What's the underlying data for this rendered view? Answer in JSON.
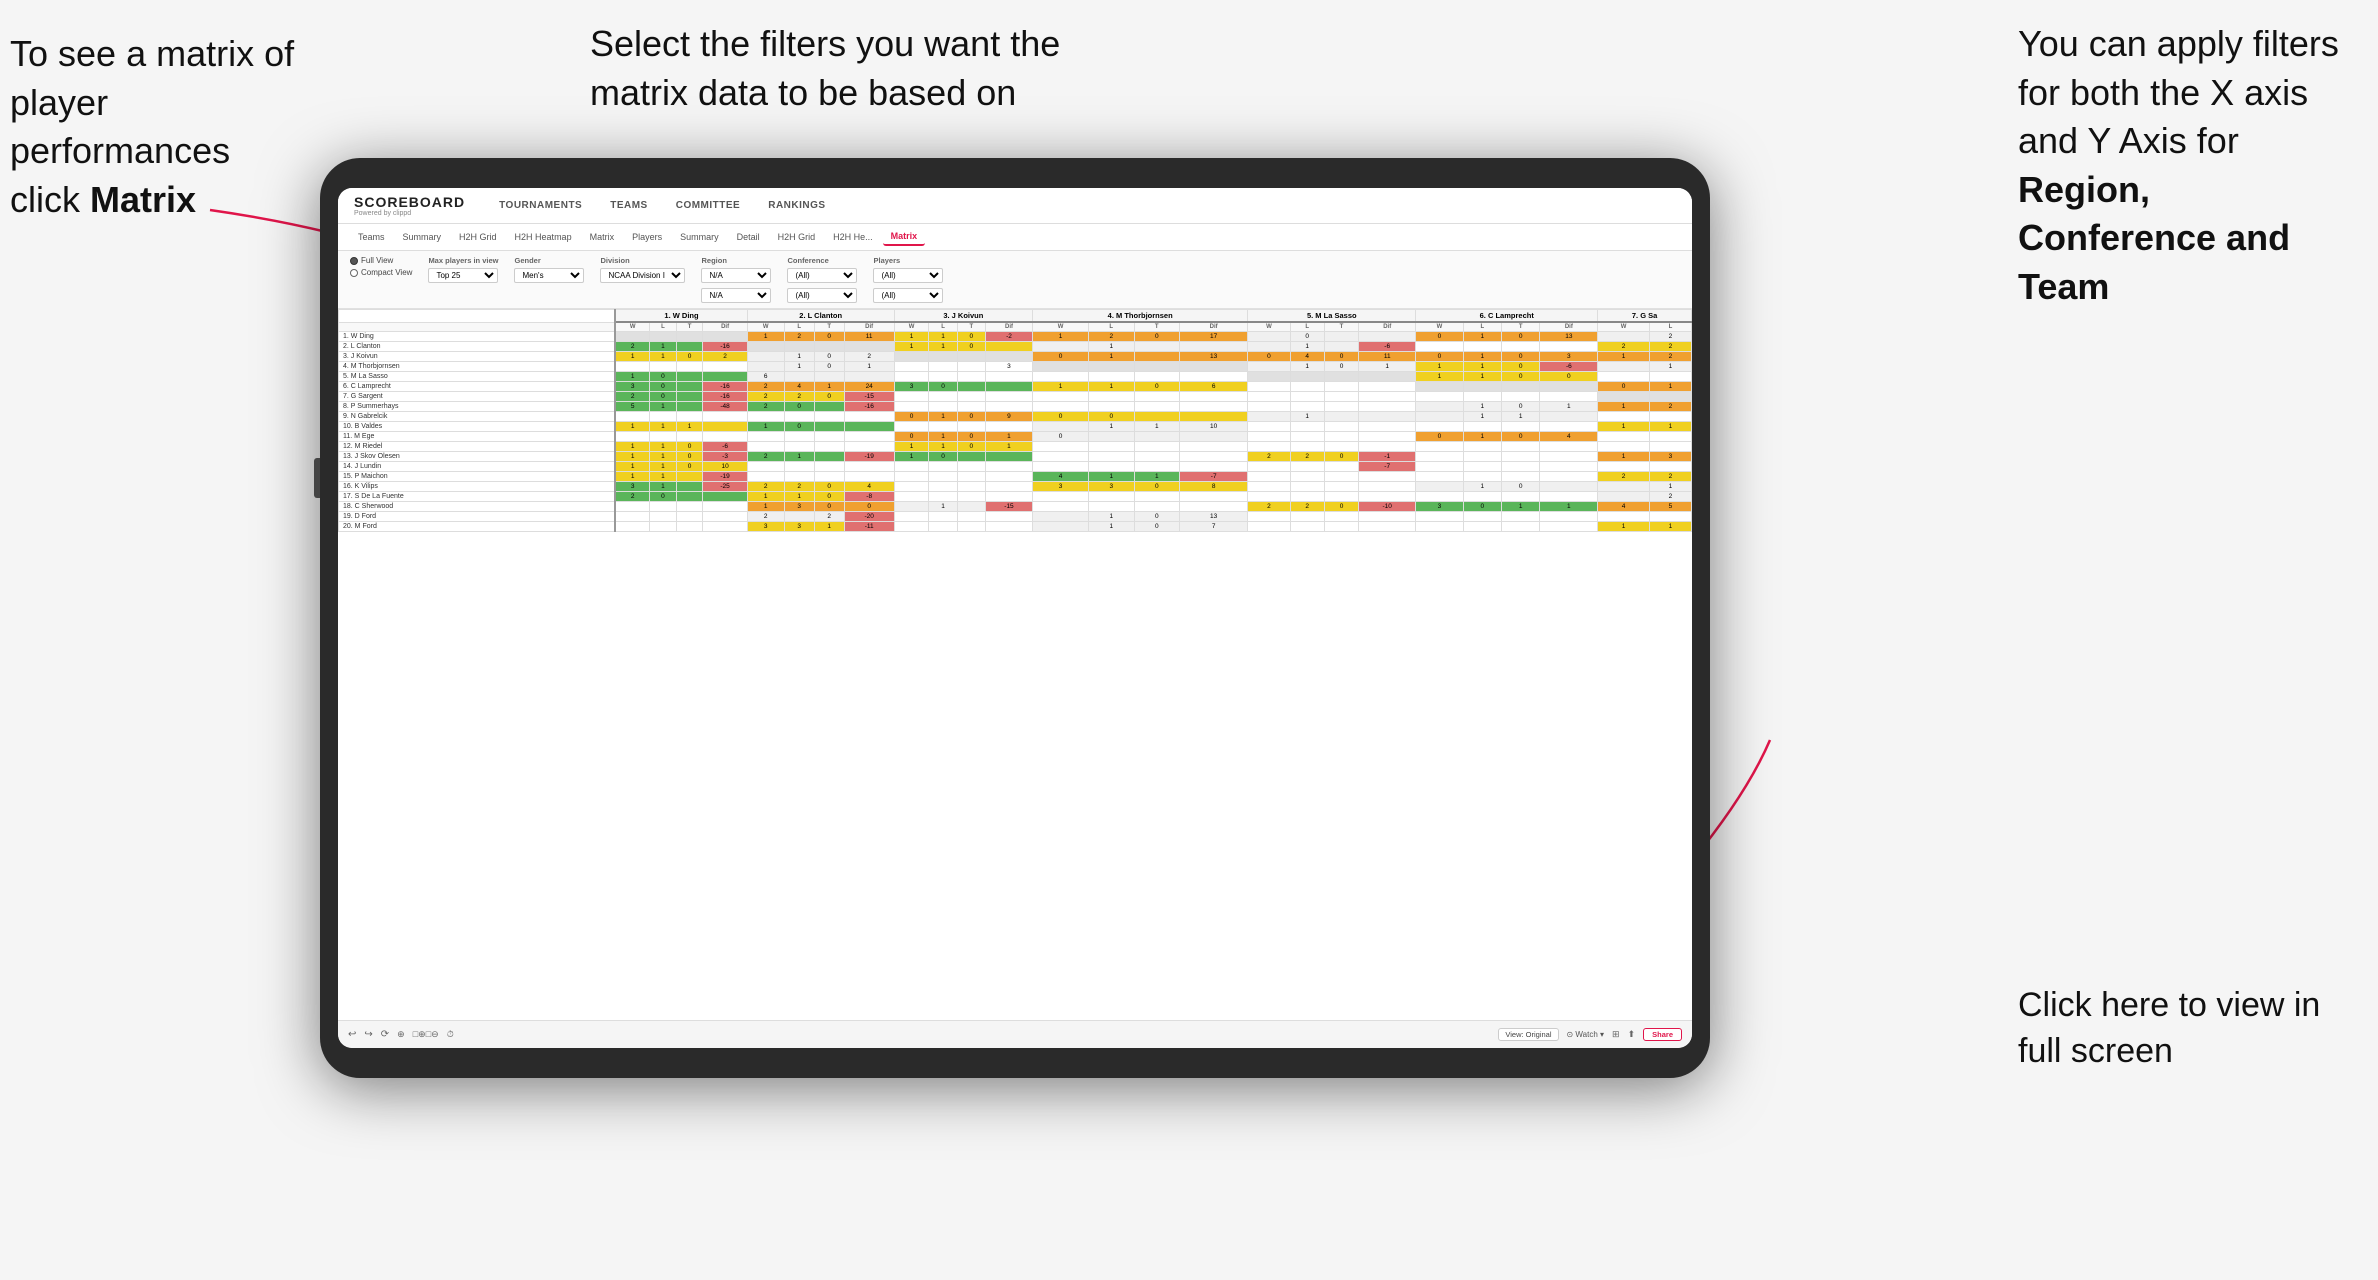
{
  "page": {
    "background": "#f5f5f5"
  },
  "annotations": {
    "top_left": {
      "line1": "To see a matrix of",
      "line2": "player performances",
      "line3": "click ",
      "bold": "Matrix"
    },
    "top_center": {
      "text": "Select the filters you want the matrix data to be based on"
    },
    "top_right": {
      "line1": "You  can apply filters for both the X axis and Y Axis for ",
      "bold1": "Region, Conference and Team"
    },
    "bottom_right": {
      "text": "Click here to view in full screen"
    }
  },
  "app": {
    "logo": "SCOREBOARD",
    "logo_sub": "Powered by clippd",
    "nav": [
      "TOURNAMENTS",
      "TEAMS",
      "COMMITTEE",
      "RANKINGS"
    ]
  },
  "sub_nav": {
    "items": [
      "Teams",
      "Summary",
      "H2H Grid",
      "H2H Heatmap",
      "Matrix",
      "Players",
      "Summary",
      "Detail",
      "H2H Grid",
      "H2H He...",
      "Matrix"
    ]
  },
  "filters": {
    "view_options": [
      "Full View",
      "Compact View"
    ],
    "selected_view": "Full View",
    "max_players_label": "Max players in view",
    "max_players_value": "Top 25",
    "gender_label": "Gender",
    "gender_value": "Men's",
    "division_label": "Division",
    "division_value": "NCAA Division I",
    "region_label": "Region",
    "region_value": "N/A",
    "conference_label": "Conference",
    "conference_value1": "(All)",
    "conference_value2": "(All)",
    "players_label": "Players",
    "players_value1": "(All)",
    "players_value2": "(All)"
  },
  "matrix": {
    "col_headers": [
      "1. W Ding",
      "2. L Clanton",
      "3. J Koivun",
      "4. M Thorbjornsen",
      "5. M La Sasso",
      "6. C Lamprecht",
      "7. G Sa"
    ],
    "sub_cols": [
      "W",
      "L",
      "T",
      "Dif"
    ],
    "rows": [
      {
        "name": "1. W Ding",
        "cells": [
          [
            null,
            null,
            null,
            null
          ],
          [
            1,
            2,
            0,
            11
          ],
          [
            1,
            1,
            0,
            null
          ],
          [
            -2
          ],
          [
            1,
            2,
            0,
            17
          ],
          [
            null,
            0,
            null,
            null
          ],
          [
            0,
            1,
            0,
            13
          ],
          [
            null,
            2
          ]
        ]
      },
      {
        "name": "2. L Clanton",
        "cells": [
          [
            2,
            1,
            null,
            -16
          ],
          [
            null,
            null,
            null,
            null
          ],
          [
            1,
            1,
            0,
            null
          ],
          [
            null
          ],
          [
            null,
            1,
            null,
            null
          ],
          [
            null,
            1,
            null,
            -6
          ],
          [
            null,
            null,
            null,
            null
          ],
          [
            2,
            2
          ]
        ]
      },
      {
        "name": "3. J Koivun",
        "cells": [
          [
            1,
            1,
            0,
            2
          ],
          [
            null,
            1,
            0,
            2
          ],
          [
            null,
            null,
            null,
            null
          ],
          [
            0,
            1,
            null,
            13
          ],
          [
            0,
            4,
            0,
            11
          ],
          [
            0,
            1,
            0,
            3
          ],
          [
            1,
            2
          ]
        ]
      },
      {
        "name": "4. M Thorbjornsen",
        "cells": [
          [
            null,
            null,
            null,
            null
          ],
          [
            null,
            1,
            0,
            1
          ],
          [
            null,
            null,
            null,
            3
          ],
          [
            null,
            null,
            null,
            null
          ],
          [
            null,
            1,
            0,
            1
          ],
          [
            1,
            1,
            0,
            -6
          ],
          [
            null,
            1
          ]
        ]
      },
      {
        "name": "5. M La Sasso",
        "cells": [
          [
            1,
            0,
            null,
            null
          ],
          [
            6,
            null,
            null,
            null
          ],
          [
            null,
            null,
            null,
            null
          ],
          [
            null,
            null,
            null,
            null
          ],
          [
            null,
            null,
            null,
            null
          ],
          [
            1,
            1,
            0,
            0
          ],
          [
            null,
            null
          ]
        ]
      },
      {
        "name": "6. C Lamprecht",
        "cells": [
          [
            3,
            0,
            null,
            -16
          ],
          [
            2,
            4,
            1,
            24
          ],
          [
            3,
            0,
            null,
            null
          ],
          [
            1,
            1,
            0,
            6
          ],
          [
            null,
            null,
            null,
            null
          ],
          [
            null,
            null,
            null,
            null
          ],
          [
            0,
            1
          ]
        ]
      },
      {
        "name": "7. G Sargent",
        "cells": [
          [
            2,
            0,
            null,
            -16
          ],
          [
            2,
            2,
            0,
            -15
          ],
          [
            null,
            null,
            null,
            null
          ],
          [
            null,
            null,
            null,
            null
          ],
          [
            null,
            null,
            null,
            null
          ],
          [
            null,
            null,
            null,
            null
          ],
          [
            null,
            null
          ]
        ]
      },
      {
        "name": "8. P Summerhays",
        "cells": [
          [
            5,
            1,
            null,
            -48
          ],
          [
            2,
            0,
            null,
            -16
          ],
          [
            null,
            null,
            null,
            null
          ],
          [
            null,
            null,
            null,
            null
          ],
          [
            null,
            null,
            null,
            null
          ],
          [
            null,
            1,
            0,
            1
          ],
          [
            1,
            2
          ]
        ]
      },
      {
        "name": "9. N Gabrelcik",
        "cells": [
          [
            null,
            null,
            null,
            null
          ],
          [
            null,
            null,
            null,
            null
          ],
          [
            0,
            1,
            0,
            9
          ],
          [
            0,
            0,
            null,
            null
          ],
          [
            null,
            1,
            null,
            null
          ],
          [
            null,
            1,
            1,
            null
          ],
          [
            null,
            null
          ]
        ]
      },
      {
        "name": "10. B Valdes",
        "cells": [
          [
            1,
            1,
            1,
            null
          ],
          [
            1,
            0,
            null,
            null
          ],
          [
            null,
            null,
            null,
            null
          ],
          [
            null,
            1,
            1,
            10
          ],
          [
            null,
            null,
            null,
            null
          ],
          [
            null,
            null,
            null,
            null
          ],
          [
            1,
            1
          ]
        ]
      },
      {
        "name": "11. M Ege",
        "cells": [
          [
            null,
            null,
            null,
            null
          ],
          [
            null,
            null,
            null,
            null
          ],
          [
            0,
            1,
            0,
            1
          ],
          [
            0,
            null,
            null,
            null
          ],
          [
            null,
            null,
            null,
            null
          ],
          [
            0,
            1,
            0,
            4
          ],
          [
            null,
            null
          ]
        ]
      },
      {
        "name": "12. M Riedel",
        "cells": [
          [
            1,
            1,
            0,
            -6
          ],
          [
            null,
            null,
            null,
            null
          ],
          [
            1,
            1,
            0,
            1
          ],
          [
            null,
            null,
            null,
            null
          ],
          [
            null,
            null,
            null,
            null
          ],
          [
            null,
            null,
            null,
            null
          ],
          [
            null,
            null
          ]
        ]
      },
      {
        "name": "13. J Skov Olesen",
        "cells": [
          [
            1,
            1,
            0,
            -3
          ],
          [
            2,
            1,
            null,
            -19
          ],
          [
            1,
            0,
            null,
            null
          ],
          [
            null,
            null,
            null,
            null
          ],
          [
            2,
            2,
            0,
            -1
          ],
          [
            null,
            null,
            null,
            null
          ],
          [
            1,
            3
          ]
        ]
      },
      {
        "name": "14. J Lundin",
        "cells": [
          [
            1,
            1,
            0,
            10
          ],
          [
            null,
            null,
            null,
            null
          ],
          [
            null,
            null,
            null,
            null
          ],
          [
            null,
            null,
            null,
            null
          ],
          [
            null,
            null,
            null,
            -7
          ],
          [
            null,
            null,
            null,
            null
          ],
          [
            null,
            null
          ]
        ]
      },
      {
        "name": "15. P Maichon",
        "cells": [
          [
            1,
            1,
            null,
            -19
          ],
          [
            null,
            null,
            null,
            null
          ],
          [
            null,
            null,
            null,
            null
          ],
          [
            4,
            1,
            1,
            -7
          ],
          [
            null,
            null,
            null,
            null
          ],
          [
            null,
            null,
            null,
            null
          ],
          [
            2,
            2
          ]
        ]
      },
      {
        "name": "16. K Vilips",
        "cells": [
          [
            3,
            1,
            null,
            -25
          ],
          [
            2,
            2,
            0,
            4
          ],
          [
            null,
            null,
            null,
            null
          ],
          [
            3,
            3,
            0,
            8
          ],
          [
            null,
            null,
            null,
            null
          ],
          [
            null,
            1,
            0,
            null
          ],
          [
            null,
            1
          ]
        ]
      },
      {
        "name": "17. S De La Fuente",
        "cells": [
          [
            2,
            0,
            null,
            null
          ],
          [
            1,
            1,
            0,
            -8
          ],
          [
            null,
            null,
            null,
            null
          ],
          [
            null,
            null,
            null,
            null
          ],
          [
            null,
            null,
            null,
            null
          ],
          [
            null,
            null,
            null,
            null
          ],
          [
            null,
            2
          ]
        ]
      },
      {
        "name": "18. C Sherwood",
        "cells": [
          [
            null,
            null,
            null,
            null
          ],
          [
            1,
            3,
            0,
            0
          ],
          [
            null,
            1,
            null,
            -15
          ],
          [
            null,
            null,
            null,
            null
          ],
          [
            2,
            2,
            0,
            -10
          ],
          [
            3,
            0,
            1,
            1
          ],
          [
            4,
            5
          ]
        ]
      },
      {
        "name": "19. D Ford",
        "cells": [
          [
            null,
            null,
            null,
            null
          ],
          [
            2,
            null,
            2,
            -20
          ],
          [
            null,
            null,
            null,
            null
          ],
          [
            null,
            1,
            0,
            13
          ],
          [
            null,
            null,
            null,
            null
          ],
          [
            null,
            null,
            null,
            null
          ],
          [
            null,
            null
          ]
        ]
      },
      {
        "name": "20. M Ford",
        "cells": [
          [
            null,
            null,
            null,
            null
          ],
          [
            3,
            3,
            1,
            -11
          ],
          [
            null,
            null,
            null,
            null
          ],
          [
            null,
            1,
            0,
            7
          ],
          [
            null,
            null,
            null,
            null
          ],
          [
            null,
            null,
            null,
            null
          ],
          [
            1,
            1
          ]
        ]
      }
    ]
  },
  "toolbar": {
    "view_btn": "View: Original",
    "watch_btn": "Watch",
    "share_btn": "Share"
  },
  "icons": {
    "undo": "↩",
    "redo": "↪",
    "reset": "⟳",
    "zoom_in": "+",
    "zoom_out": "−",
    "clock": "⏱",
    "share": "⬆"
  }
}
